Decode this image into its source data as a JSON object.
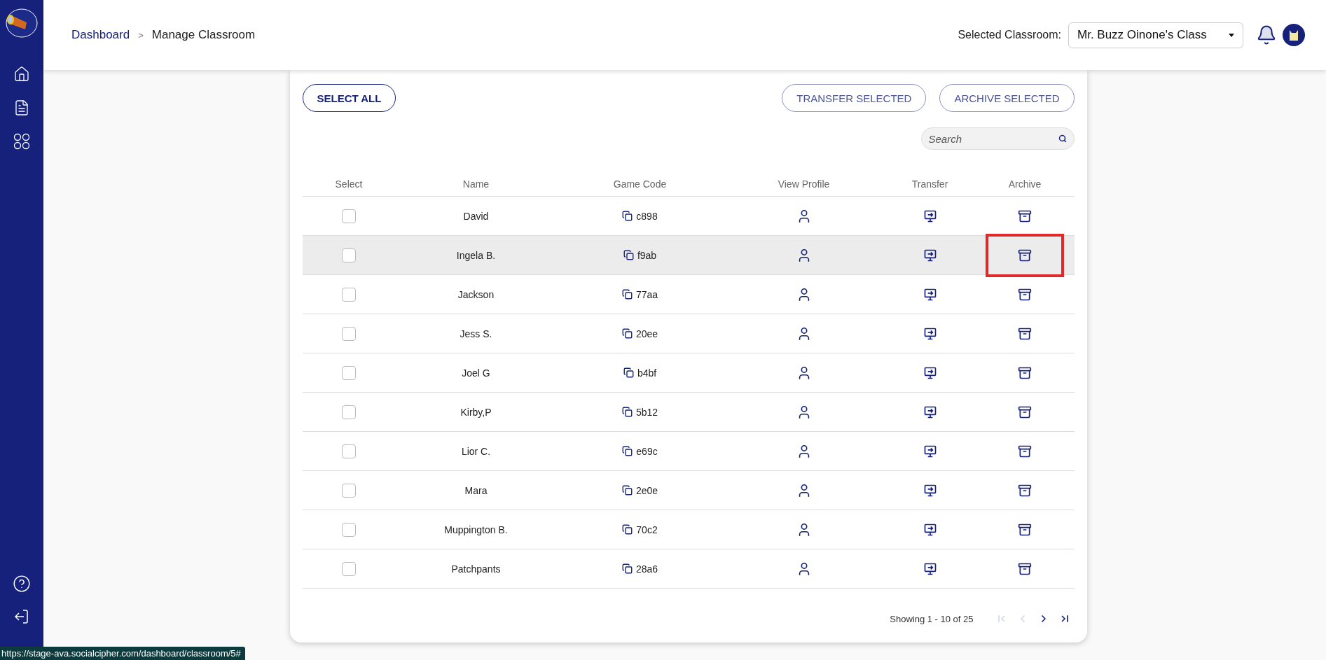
{
  "breadcrumb": {
    "parent": "Dashboard",
    "separator": ">",
    "current": "Manage Classroom"
  },
  "classroom_select": {
    "label": "Selected Classroom:",
    "value": "Mr. Buzz Oinone's Class"
  },
  "toolbar": {
    "select_all": "SELECT ALL",
    "transfer_selected": "TRANSFER SELECTED",
    "archive_selected": "ARCHIVE SELECTED"
  },
  "search": {
    "placeholder": "Search"
  },
  "table": {
    "columns": [
      "Select",
      "Name",
      "Game Code",
      "View Profile",
      "Transfer",
      "Archive"
    ],
    "rows": [
      {
        "name": "David",
        "code": "c898",
        "checked": false,
        "highlighted": false,
        "marked": false
      },
      {
        "name": "Ingela B.",
        "code": "f9ab",
        "checked": false,
        "highlighted": true,
        "marked": true
      },
      {
        "name": "Jackson",
        "code": "77aa",
        "checked": false,
        "highlighted": false,
        "marked": false
      },
      {
        "name": "Jess S.",
        "code": "20ee",
        "checked": false,
        "highlighted": false,
        "marked": false
      },
      {
        "name": "Joel G",
        "code": "b4bf",
        "checked": false,
        "highlighted": false,
        "marked": false
      },
      {
        "name": "Kirby,P",
        "code": "5b12",
        "checked": false,
        "highlighted": false,
        "marked": false
      },
      {
        "name": "Lior C.",
        "code": "e69c",
        "checked": false,
        "highlighted": false,
        "marked": false
      },
      {
        "name": "Mara",
        "code": "2e0e",
        "checked": false,
        "highlighted": false,
        "marked": false
      },
      {
        "name": "Muppington B.",
        "code": "70c2",
        "checked": false,
        "highlighted": false,
        "marked": false
      },
      {
        "name": "Patchpants",
        "code": "28a6",
        "checked": false,
        "highlighted": false,
        "marked": false
      }
    ]
  },
  "pagination": {
    "summary": "Showing 1 - 10 of 25",
    "first_disabled": true,
    "prev_disabled": true,
    "next_disabled": false,
    "last_disabled": false
  },
  "status_url": "https://stage-ava.socialcipher.com/dashboard/classroom/5#"
}
